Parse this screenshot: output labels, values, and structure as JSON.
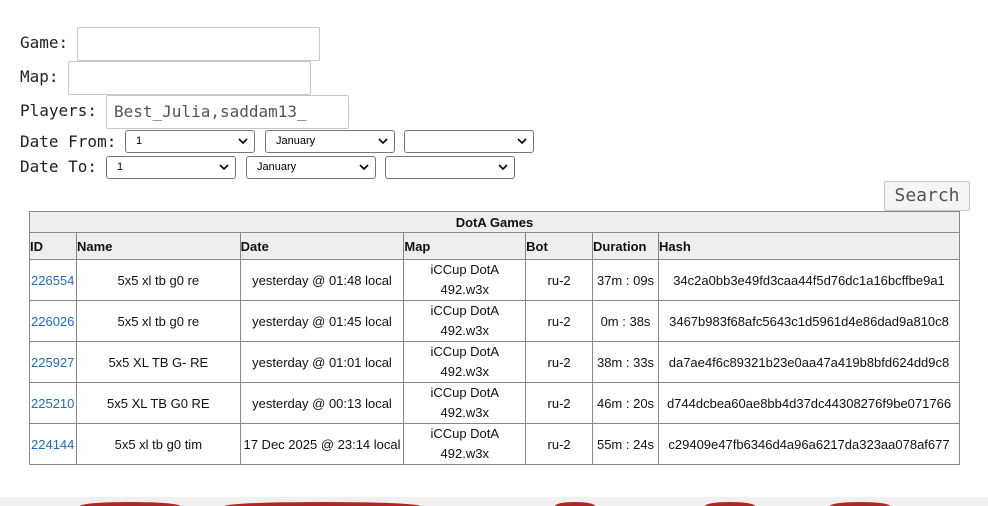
{
  "form": {
    "game_label": "Game:",
    "game_value": "",
    "map_label": "Map:",
    "map_value": "",
    "players_label": "Players:",
    "players_value": "Best_Julia,saddam13_",
    "date_from_label": "Date From:",
    "date_from_day": "1",
    "date_from_month": "January",
    "date_from_year": "",
    "date_to_label": "Date To:",
    "date_to_day": "1",
    "date_to_month": "January",
    "date_to_year": "",
    "search_label": "Search"
  },
  "table": {
    "caption": "DotA Games",
    "headers": [
      "ID",
      "Name",
      "Date",
      "Map",
      "Bot",
      "Duration",
      "Hash"
    ],
    "rows": [
      {
        "id": "226554",
        "name": "5x5 xl tb g0 re",
        "date": "yesterday @ 01:48 local",
        "map_line1": "iCCup DotA",
        "map_line2": "492.w3x",
        "bot": "ru-2",
        "duration": "37m : 09s",
        "hash": "34c2a0bb3e49fd3caa44f5d76dc1a16bcffbe9a1"
      },
      {
        "id": "226026",
        "name": "5x5 xl tb g0 re",
        "date": "yesterday @ 01:45 local",
        "map_line1": "iCCup DotA",
        "map_line2": "492.w3x",
        "bot": "ru-2",
        "duration": "0m : 38s",
        "hash": "3467b983f68afc5643c1d5961d4e86dad9a810c8"
      },
      {
        "id": "225927",
        "name": "5x5 XL TB G- RE",
        "date": "yesterday @ 01:01 local",
        "map_line1": "iCCup DotA",
        "map_line2": "492.w3x",
        "bot": "ru-2",
        "duration": "38m : 33s",
        "hash": "da7ae4f6c89321b23e0aa47a419b8bfd624dd9c8"
      },
      {
        "id": "225210",
        "name": "5x5 XL TB G0 RE",
        "date": "yesterday @ 00:13 local",
        "map_line1": "iCCup DotA",
        "map_line2": "492.w3x",
        "bot": "ru-2",
        "duration": "46m : 20s",
        "hash": "d744dcbea60ae8bb4d37dc44308276f9be071766"
      },
      {
        "id": "224144",
        "name": "5x5 xl tb g0 tim",
        "date": "17 Dec 2025 @ 23:14 local",
        "map_line1": "iCCup DotA",
        "map_line2": "492.w3x",
        "bot": "ru-2",
        "duration": "55m : 24s",
        "hash": "c29409e47fb6346d4a96a6217da323aa078af677"
      }
    ]
  },
  "colors": {
    "link": "#1a6fc0",
    "header_bg": "#eeeeee",
    "footer_accent": "#b52525"
  }
}
